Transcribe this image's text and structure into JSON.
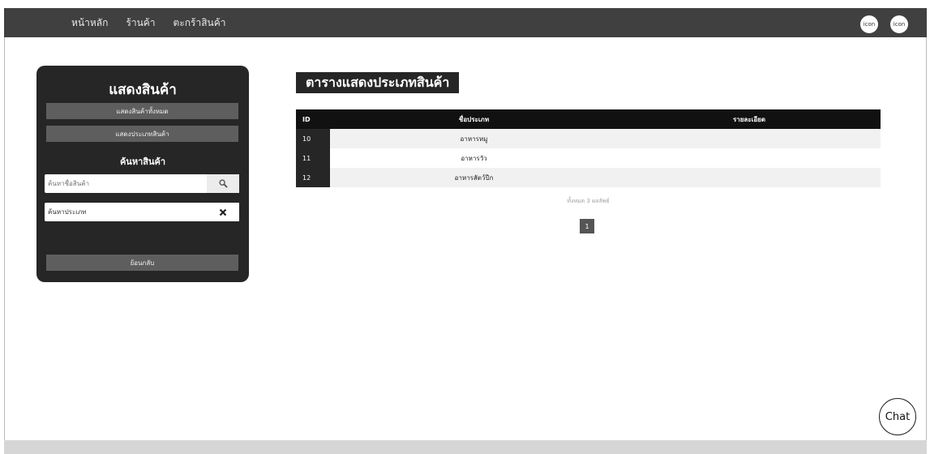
{
  "nav": {
    "home": "หน้าหลัก",
    "shop": "ร้านค้า",
    "cart": "ตะกร้าสินค้า"
  },
  "header_icons": {
    "left": "icon",
    "right": "icon"
  },
  "sidebar": {
    "title": "แสดงสินค้า",
    "show_all_button": "แสดงสินค้าทั้งหมด",
    "show_types_button": "แสดงประเภทสินค้า",
    "search_title": "ค้นหาสินค้า",
    "search_name_placeholder": "ค้นหาชื่อสินค้า",
    "search_type_value": "ค้นหาประเภท",
    "back_button": "ย้อนกลับ"
  },
  "main": {
    "title": "ตารางแสดงประเภทสินค้า",
    "table": {
      "headers": [
        "ID",
        "ชื่อประเภท",
        "รายละเอียด"
      ],
      "rows": [
        {
          "id": "10",
          "name": "อาหารหมู",
          "detail": ""
        },
        {
          "id": "11",
          "name": "อาหารวัว",
          "detail": ""
        },
        {
          "id": "12",
          "name": "อาหารสัตว์ปีก",
          "detail": ""
        }
      ]
    },
    "result_count": "ทั้งหมด 3 ผลลัพธ์",
    "current_page": "1"
  },
  "chat_button": "Chat"
}
